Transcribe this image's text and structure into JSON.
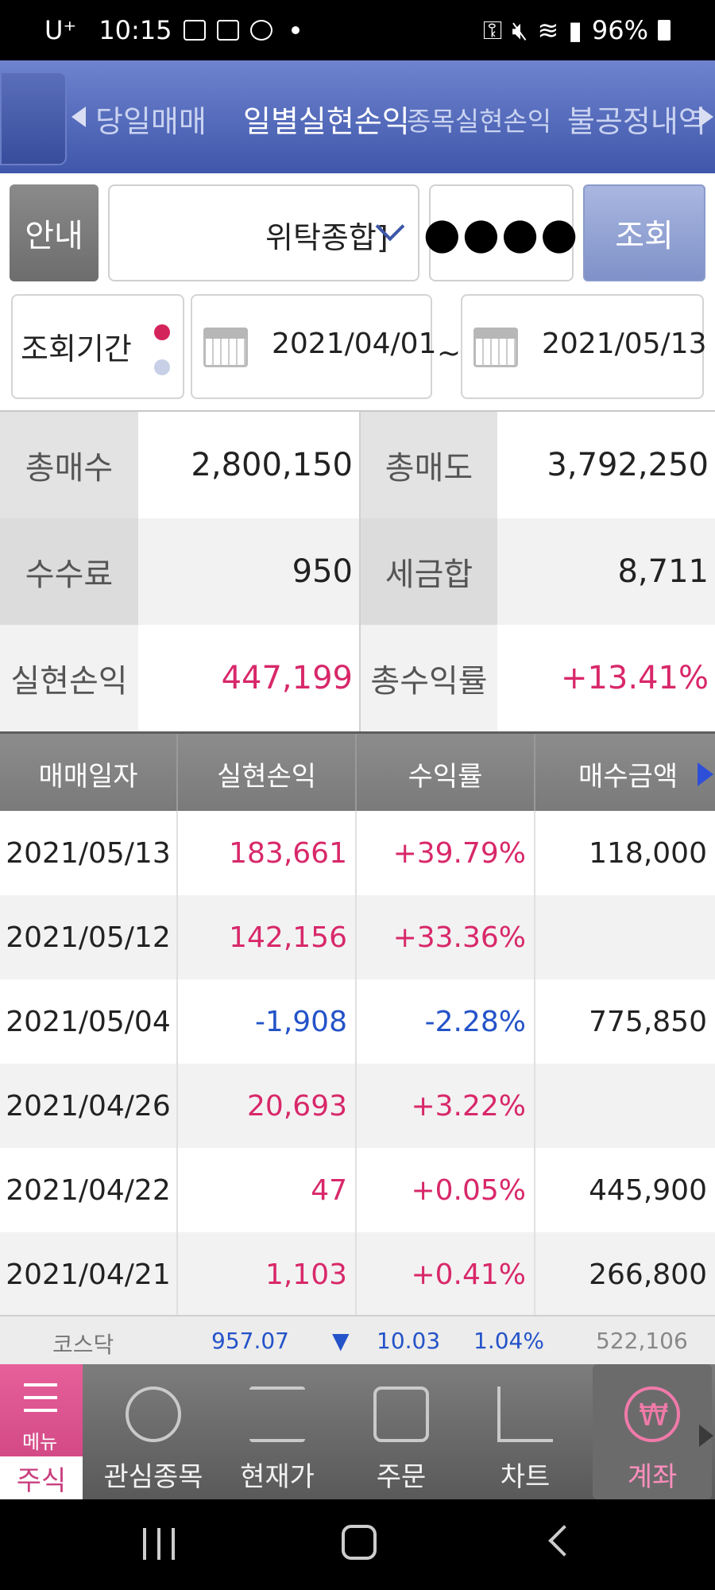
{
  "status_bar": {
    "carrier": "U⁺",
    "time": "10:15",
    "battery": "96%"
  },
  "tabs": [
    {
      "label": "당일매매"
    },
    {
      "label": "일별실현손익",
      "active": true
    },
    {
      "label": "종목실현손익"
    },
    {
      "label": "불공정내역"
    }
  ],
  "controls": {
    "guide_label": "안내",
    "account_type": "위탁종합]",
    "password_mask": "●●●●",
    "query_label": "조회"
  },
  "period": {
    "label": "조회기간",
    "start_date": "2021/04/01",
    "separator": "~",
    "end_date": "2021/05/13"
  },
  "summary": {
    "total_buy_label": "총매수",
    "total_buy": "2,800,150",
    "total_sell_label": "총매도",
    "total_sell": "3,792,250",
    "fee_label": "수수료",
    "fee": "950",
    "tax_label": "세금합",
    "tax": "8,711",
    "realized_pl_label": "실현손익",
    "realized_pl": "447,199",
    "total_return_label": "총수익률",
    "total_return": "+13.41%"
  },
  "table": {
    "headers": [
      "매매일자",
      "실현손익",
      "수익률",
      "매수금액"
    ],
    "rows": [
      {
        "date": "2021/05/13",
        "pl": "183,661",
        "rate": "+39.79%",
        "buy": "118,000",
        "sign": "pos"
      },
      {
        "date": "2021/05/12",
        "pl": "142,156",
        "rate": "+33.36%",
        "buy": "",
        "sign": "pos"
      },
      {
        "date": "2021/05/04",
        "pl": "-1,908",
        "rate": "-2.28%",
        "buy": "775,850",
        "sign": "neg"
      },
      {
        "date": "2021/04/26",
        "pl": "20,693",
        "rate": "+3.22%",
        "buy": "",
        "sign": "pos"
      },
      {
        "date": "2021/04/22",
        "pl": "47",
        "rate": "+0.05%",
        "buy": "445,900",
        "sign": "pos"
      },
      {
        "date": "2021/04/21",
        "pl": "1,103",
        "rate": "+0.41%",
        "buy": "266,800",
        "sign": "pos"
      }
    ]
  },
  "ticker": {
    "name": "코스닥",
    "index": "957.07",
    "arrow": "▼",
    "change": "10.03",
    "pct": "1.04%",
    "volume": "522,106"
  },
  "bottom_nav": {
    "menu_label": "메뉴",
    "stock_label": "주식",
    "items": [
      {
        "label": "관심종목",
        "icon": "watchlist-icon"
      },
      {
        "label": "현재가",
        "icon": "current-price-icon"
      },
      {
        "label": "주문",
        "icon": "order-icon"
      },
      {
        "label": "차트",
        "icon": "chart-icon"
      },
      {
        "label": "계좌",
        "icon": "won-icon",
        "active": true
      }
    ],
    "won_symbol": "₩"
  },
  "colors": {
    "positive": "#d8286a",
    "negative": "#2453c9",
    "header_blue": "#4a60b3"
  }
}
